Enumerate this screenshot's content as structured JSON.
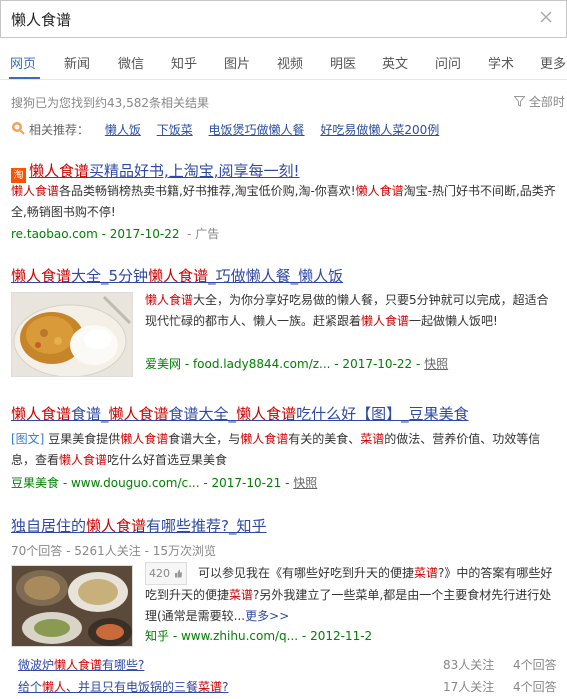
{
  "search": {
    "query": "懒人食谱"
  },
  "tabs": [
    "网页",
    "新闻",
    "微信",
    "知乎",
    "图片",
    "视频",
    "明医",
    "英文",
    "问问",
    "学术",
    "更多"
  ],
  "result_count": "搜狗已为您找到约43,582条相关结果",
  "filter_label": "全部时",
  "related": {
    "label": "相关推荐：",
    "items": [
      "懒人饭",
      "下饭菜",
      "电饭煲巧做懒人餐",
      "好吃易做懒人菜200例"
    ]
  },
  "ad_icon": "淘",
  "results": [
    {
      "title_em1": "懒人食谱",
      "title_rest": "买精品好书,上淘宝,阅享每一刻!",
      "snippet_a_em": "懒人食谱",
      "snippet_a": "各品类畅销榜热卖书籍,好书推荐,淘宝低价购,淘-你喜欢!",
      "snippet_b_em": "懒人食谱",
      "snippet_b": "淘宝-热门好书不间断,品类齐全,畅销图书购不停!",
      "url": "re.taobao.com - 2017-10-22",
      "ad": "- 广告"
    },
    {
      "title": "懒人食谱大全_5分钟懒人食谱_巧做懒人餐_懒人饭",
      "snippet_em1": "懒人食谱",
      "snippet_1": "大全，为你分享好吃易做的懒人餐，只要5分钟就可以完成，超适合现代忙碌的都市人、懒人一族。赶紧跟着",
      "snippet_em2": "懒人食谱",
      "snippet_2": "一起做懒人饭吧!",
      "url": "爱美网 - food.lady8844.com/z... - 2017-10-22 -",
      "snapshot": "快照"
    },
    {
      "title": "懒人食谱食谱_懒人食谱食谱大全_懒人食谱吃什么好【图】_豆果美食",
      "tag": "[图文]",
      "snippet_1": " 豆果美食提供",
      "snippet_em1": "懒人食谱",
      "snippet_2": "食谱大全，与",
      "snippet_em2": "懒人食谱",
      "snippet_3": "有关的美食、",
      "snippet_em3": "菜谱",
      "snippet_4": "的做法、营养价值、功效等信息，查看",
      "snippet_em4": "懒人食谱",
      "snippet_5": "吃什么好首选豆果美食",
      "url": "豆果美食 - www.douguo.com/c... - 2017-10-21 -",
      "snapshot": "快照"
    },
    {
      "title": "独自居住的懒人食谱有哪些推荐?_知乎",
      "meta": "70个回答 - 5261人关注 - 15万次浏览",
      "votes": "420",
      "snippet_1": "可以参见我在《有哪些好吃到升天的便捷",
      "snippet_em1": "菜谱",
      "snippet_2": "?》中的答案有哪些好吃到升天的便捷",
      "snippet_em2": "菜谱",
      "snippet_3": "?另外我建立了一些菜单,都是由一个主要食材先行进行处理(通常是需要较...",
      "more": "更多>>",
      "url": "知乎 - www.zhihu.com/q... - 2012-11-2",
      "questions": [
        {
          "text": "微波炉懒人食谱有哪些?",
          "follow": "83人关注",
          "answers": "4个回答"
        },
        {
          "text": "给个懒人、并且只有电饭锅的三餐菜谱?",
          "follow": "17人关注",
          "answers": "4个回答"
        }
      ]
    }
  ]
}
